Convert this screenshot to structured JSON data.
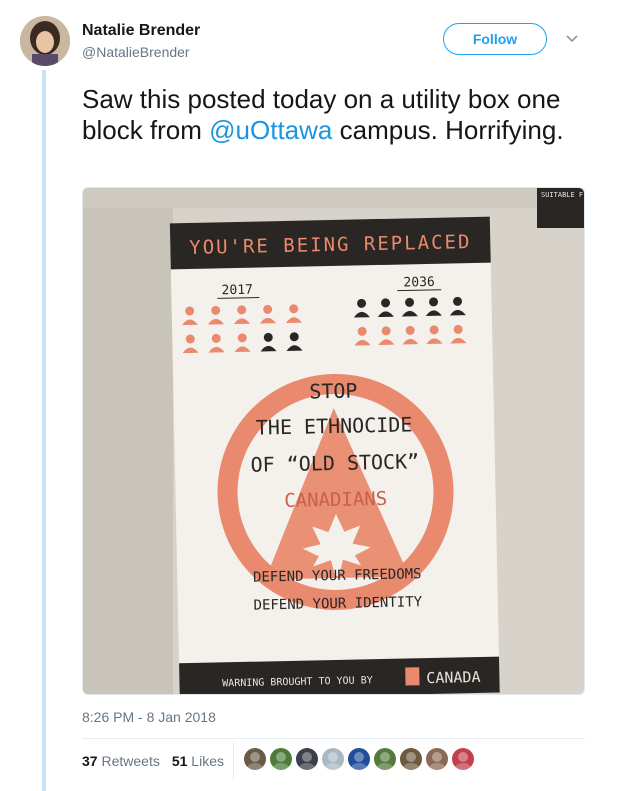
{
  "author": {
    "name": "Natalie Brender",
    "handle": "@NatalieBrender"
  },
  "follow_label": "Follow",
  "tweet": {
    "text_before": "Saw this posted today on a utility box one block from ",
    "mention": "@uOttawa",
    "text_after": " campus. Horrifying."
  },
  "photo": {
    "poster_header": "YOU'RE BEING REPLACED",
    "year_left": "2017",
    "year_right": "2036",
    "line1": "STOP",
    "line2": "THE ETHNOCIDE",
    "line3": "OF “OLD STOCK”",
    "line4": "CANADIANS",
    "line5": "DEFEND YOUR FREEDOMS",
    "line6": "DEFEND YOUR IDENTITY",
    "footer": "WARNING BROUGHT TO YOU BY",
    "footer_brand": "CANADA",
    "sticker": "SUITABLE F USE AS SERV ENTRANCE EQUIPMEN",
    "colors": {
      "wall": "#d9d5cc",
      "poster": "#f4f1ec",
      "accent": "#e98a6f",
      "dark": "#2a2623"
    }
  },
  "timestamp": "8:26 PM - 8 Jan 2018",
  "stats": {
    "retweets_count": "37",
    "retweets_label": "Retweets",
    "likes_count": "51",
    "likes_label": "Likes"
  },
  "likers": [
    {
      "color": "#6b5a48"
    },
    {
      "color": "#4e7a3a"
    },
    {
      "color": "#3a3f4a"
    },
    {
      "color": "#aab8c2"
    },
    {
      "color": "#1f4e9c"
    },
    {
      "color": "#557a3e"
    },
    {
      "color": "#6f5a40"
    },
    {
      "color": "#8a6a55"
    },
    {
      "color": "#c2404c"
    }
  ],
  "theme": {
    "link": "#1b95e0",
    "follow": "#1da1f2",
    "muted": "#657786"
  }
}
